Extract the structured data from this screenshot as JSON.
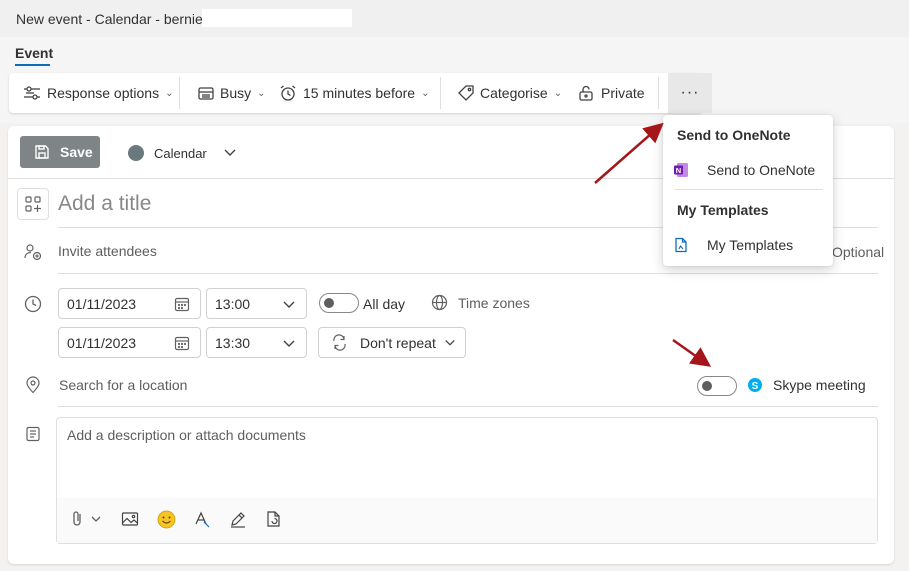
{
  "window": {
    "title": "New event - Calendar - bernie"
  },
  "ribbon": {
    "tab_event": "Event",
    "response_options": "Response options",
    "busy": "Busy",
    "reminder": "15 minutes before",
    "categorise": "Categorise",
    "private": "Private",
    "more": "···"
  },
  "form": {
    "save_label": "Save",
    "calendar_label": "Calendar",
    "title_placeholder": "Add a title",
    "invite_placeholder": "Invite attendees",
    "optional_text": "Optional",
    "start_date": "01/11/2023",
    "start_time": "13:00",
    "end_date": "01/11/2023",
    "end_time": "13:30",
    "all_day": "All day",
    "time_zones": "Time zones",
    "repeat": "Don't repeat",
    "location_placeholder": "Search for a location",
    "skype_meeting": "Skype meeting",
    "description_placeholder": "Add a description or attach documents"
  },
  "more_menu": {
    "section1_header": "Send to OneNote",
    "section1_item": "Send to OneNote",
    "section2_header": "My Templates",
    "section2_item": "My Templates"
  },
  "colors": {
    "accent": "#0f6cbd",
    "save_button_bg": "#7f8586",
    "calendar_dot": "#69797e",
    "annotation_arrow": "#a4161a",
    "onenote_purple": "#7719aa",
    "skype_blue": "#00aff0"
  },
  "icons": {
    "response_options": "response-options-icon",
    "busy": "busy-icon",
    "reminder": "alarm-clock-icon",
    "categorise": "tag-icon",
    "private": "lock-icon"
  }
}
